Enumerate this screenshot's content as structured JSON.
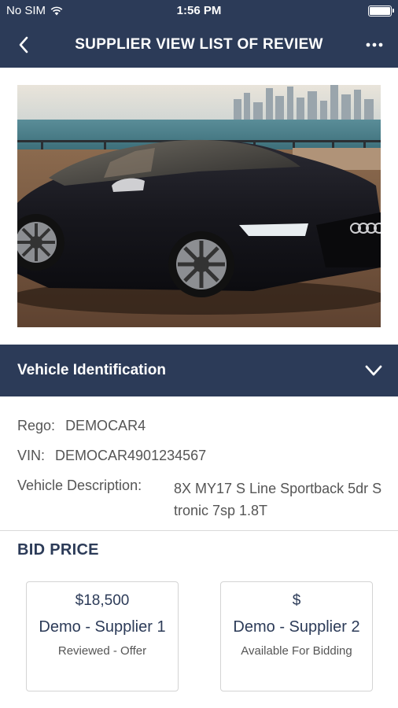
{
  "status_bar": {
    "carrier": "No SIM",
    "time": "1:56 PM"
  },
  "nav": {
    "title": "SUPPLIER VIEW LIST OF REVIEW",
    "back_icon": "chevron-left-icon",
    "more_icon": "more-horizontal-icon"
  },
  "vehicle_section": {
    "title": "Vehicle Identification",
    "chevron_icon": "chevron-down-icon"
  },
  "details": {
    "rego_label": "Rego:",
    "rego_value": "DEMOCAR4",
    "vin_label": "VIN:",
    "vin_value": "DEMOCAR4901234567",
    "description_label": "Vehicle Description:",
    "description_value": "8X MY17 S Line Sportback 5dr S tronic 7sp 1.8T"
  },
  "bid": {
    "heading": "BID PRICE",
    "cards": [
      {
        "amount": "$18,500",
        "supplier": "Demo - Supplier 1",
        "status": "Reviewed - Offer"
      },
      {
        "amount": "$",
        "supplier": "Demo - Supplier 2",
        "status": "Available For Bidding"
      }
    ]
  },
  "colors": {
    "primary": "#2c3b58",
    "text": "#555555",
    "border": "#d4d4d4"
  }
}
